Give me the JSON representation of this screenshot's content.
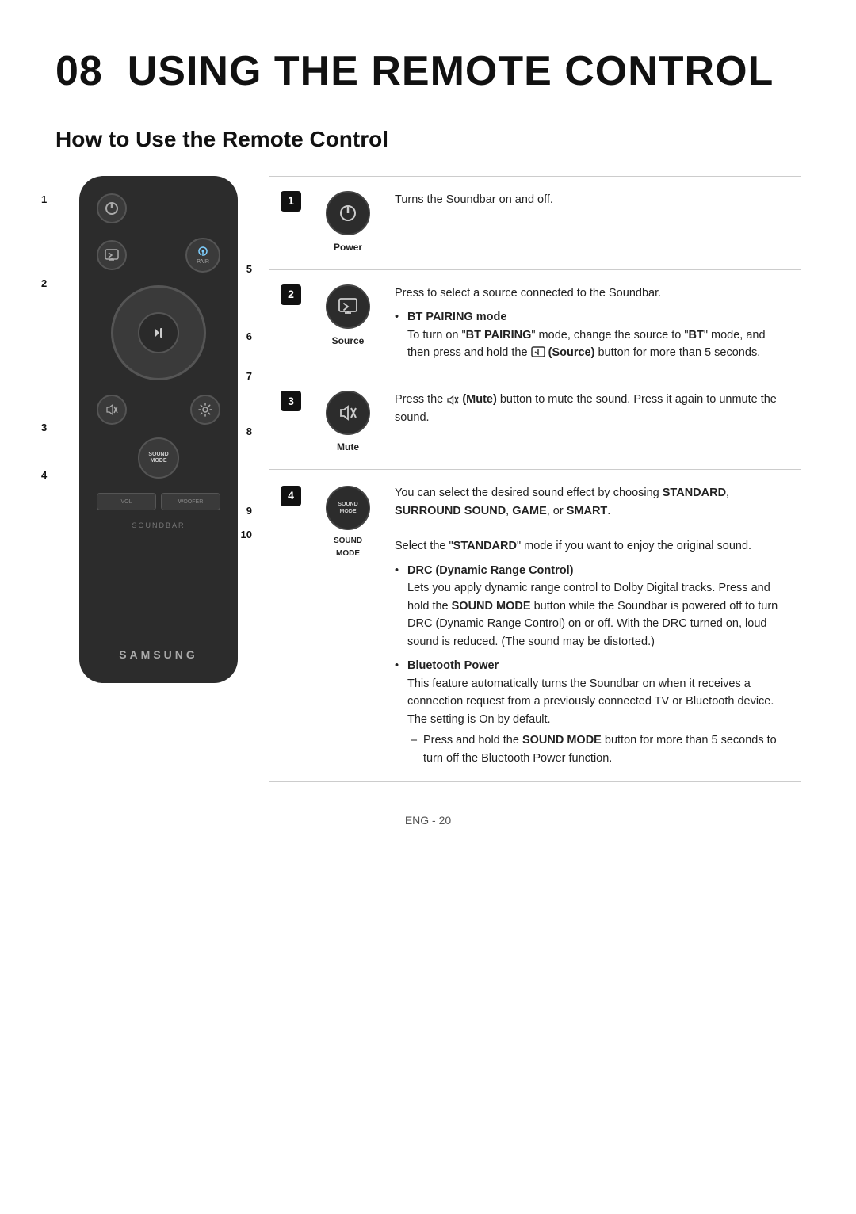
{
  "page": {
    "chapter": "08",
    "title": "USING THE REMOTE CONTROL",
    "section": "How to Use the Remote Control",
    "page_num": "ENG - 20"
  },
  "remote": {
    "labels": {
      "pair": "PAIR",
      "soundbar": "SOUNDBAR",
      "samsung": "SAMSUNG",
      "vol": "VOL",
      "woofer": "WOOFER",
      "sound_mode": "SOUND MODE"
    },
    "number_labels": [
      "1",
      "2",
      "3",
      "4",
      "5",
      "6",
      "7",
      "8",
      "9",
      "10"
    ]
  },
  "table": {
    "rows": [
      {
        "num": "1",
        "button_label": "Power",
        "desc": "Turns the Soundbar on and off."
      },
      {
        "num": "2",
        "button_label": "Source",
        "desc_intro": "Press to select a source connected to the Soundbar.",
        "bullets": [
          {
            "bold_label": "BT PAIRING mode",
            "text": "To turn on \"BT PAIRING\" mode, change the source to \"BT\" mode, and then press and hold the (Source) button for more than 5 seconds."
          }
        ]
      },
      {
        "num": "3",
        "button_label": "Mute",
        "desc": "Press the (Mute) button to mute the sound. Press it again to unmute the sound."
      },
      {
        "num": "4",
        "button_label": "SOUND MODE",
        "desc_intro": "You can select the desired sound effect by choosing STANDARD, SURROUND SOUND, GAME, or SMART.",
        "desc_extra": "Select the \"STANDARD\" mode if you want to enjoy the original sound.",
        "bullets": [
          {
            "bold_label": "DRC (Dynamic Range Control)",
            "text": "Lets you apply dynamic range control to Dolby Digital tracks. Press and hold the SOUND MODE button while the Soundbar is powered off to turn DRC (Dynamic Range Control) on or off. With the DRC turned on, loud sound is reduced. (The sound may be distorted.)"
          },
          {
            "bold_label": "Bluetooth Power",
            "text": "This feature automatically turns the Soundbar on when it receives a connection request from a previously connected TV or Bluetooth device. The setting is On by default.",
            "sub_bullets": [
              "Press and hold the SOUND MODE button for more than 5 seconds to turn off the Bluetooth Power function."
            ]
          }
        ]
      }
    ]
  }
}
